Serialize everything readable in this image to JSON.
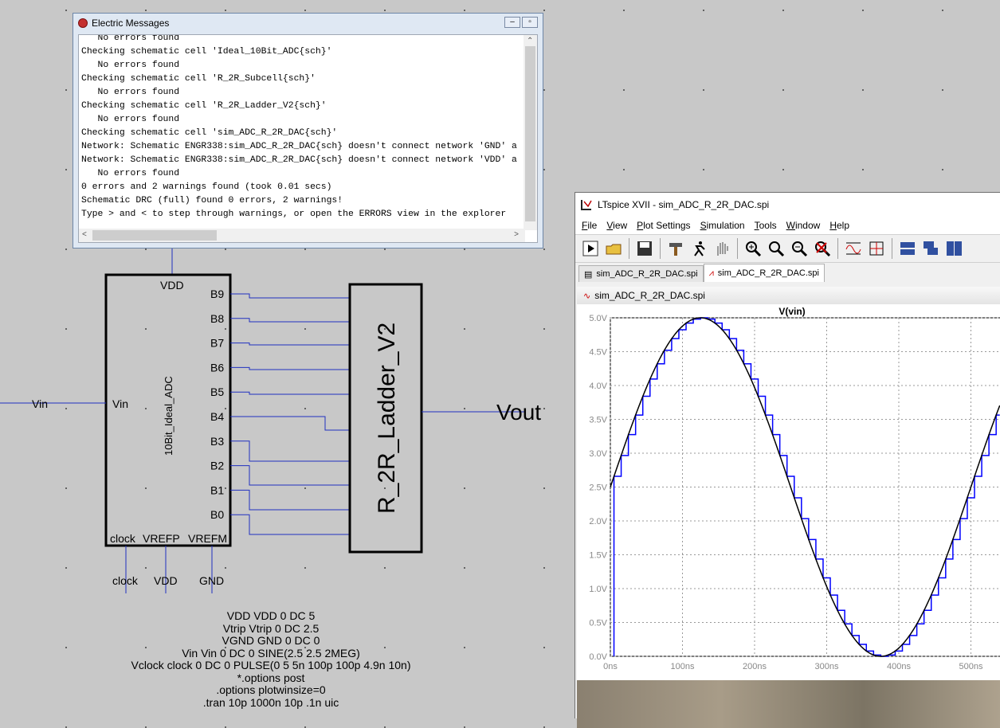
{
  "electric_messages": {
    "title": "Electric Messages",
    "lines": [
      "   No errors found",
      "Checking schematic cell 'Ideal_10Bit_ADC{sch}'",
      "   No errors found",
      "Checking schematic cell 'R_2R_Subcell{sch}'",
      "   No errors found",
      "Checking schematic cell 'R_2R_Ladder_V2{sch}'",
      "   No errors found",
      "Checking schematic cell 'sim_ADC_R_2R_DAC{sch}'",
      "Network: Schematic ENGR338:sim_ADC_R_2R_DAC{sch} doesn't connect network 'GND' a",
      "Network: Schematic ENGR338:sim_ADC_R_2R_DAC{sch} doesn't connect network 'VDD' a",
      "   No errors found",
      "0 errors and 2 warnings found (took 0.01 secs)",
      "Schematic DRC (full) found 0 errors, 2 warnings!",
      "Type > and < to step through warnings, or open the ERRORS view in the explorer"
    ]
  },
  "schematic": {
    "adc_name": "10Bit_Ideal_ADC",
    "adc_pins_top": "VDD",
    "adc_pins_right": [
      "B9",
      "B8",
      "B7",
      "B6",
      "B5",
      "B4",
      "B3",
      "B2",
      "B1",
      "B0"
    ],
    "adc_pin_left": "Vin",
    "adc_pins_bottom": [
      "clock",
      "VREFP",
      "VREFM"
    ],
    "ladder_name": "R_2R_Ladder_V2",
    "input_label": "Vin",
    "output_label": "Vout",
    "bottom_net_labels": [
      "clock",
      "VDD",
      "GND"
    ],
    "netlist": [
      "VDD VDD 0 DC 5",
      "Vtrip Vtrip 0 DC 2.5",
      "VGND GND 0 DC 0",
      "Vin Vin 0 DC 0 SINE(2.5 2.5 2MEG)",
      "Vclock clock 0 DC 0 PULSE(0 5 5n 100p 100p 4.9n 10n)",
      "*.options post",
      ".options plotwinsize=0",
      ".tran 10p 1000n 10p .1n uic"
    ]
  },
  "ltspice": {
    "title": "LTspice XVII - sim_ADC_R_2R_DAC.spi",
    "menu": [
      "File",
      "View",
      "Plot Settings",
      "Simulation",
      "Tools",
      "Window",
      "Help"
    ],
    "tabs": [
      "sim_ADC_R_2R_DAC.spi",
      "sim_ADC_R_2R_DAC.spi"
    ],
    "plot_window_title": "sim_ADC_R_2R_DAC.spi",
    "colors": {
      "trace_vin": "#000000",
      "trace_dac": "#0000ff"
    }
  },
  "chart_data": {
    "type": "line",
    "title": "V(vin)",
    "xlabel": "",
    "ylabel": "",
    "x_ticks": [
      "0ns",
      "100ns",
      "200ns",
      "300ns",
      "400ns",
      "500ns"
    ],
    "y_ticks": [
      "0.0V",
      "0.5V",
      "1.0V",
      "1.5V",
      "2.0V",
      "2.5V",
      "3.0V",
      "3.5V",
      "4.0V",
      "4.5V",
      "5.0V"
    ],
    "xlim": [
      0,
      540
    ],
    "ylim": [
      0,
      5
    ],
    "series": [
      {
        "name": "V(vin)",
        "function": "2.5+2.5*sin(2*pi*2e6*t)",
        "x_start": 0,
        "x_end": 540,
        "color": "#000000"
      },
      {
        "name": "",
        "function": "staircase of 10-bit DAC output sampled every 10ns",
        "color": "#0000ff"
      }
    ]
  }
}
